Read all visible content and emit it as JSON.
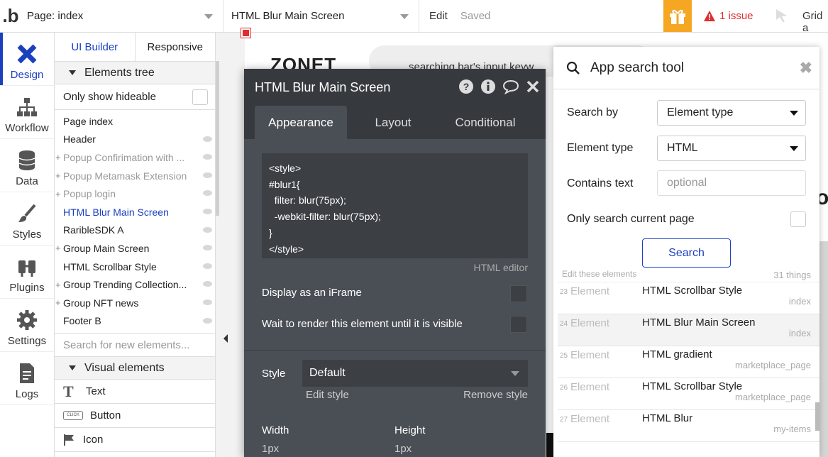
{
  "topbar": {
    "logo": ".b",
    "page_select": "Page: index",
    "element_select": "HTML Blur Main Screen",
    "edit": "Edit",
    "saved": "Saved",
    "issues": "1 issue",
    "grid": "Grid a",
    "accent": "#f5a623",
    "issue_color": "#e02e2e"
  },
  "leftnav": [
    {
      "label": "Design",
      "icon": "design-icon",
      "active": true
    },
    {
      "label": "Workflow",
      "icon": "workflow-icon"
    },
    {
      "label": "Data",
      "icon": "database-icon"
    },
    {
      "label": "Styles",
      "icon": "brush-icon"
    },
    {
      "label": "Plugins",
      "icon": "plug-icon"
    },
    {
      "label": "Settings",
      "icon": "gear-icon"
    },
    {
      "label": "Logs",
      "icon": "document-icon"
    }
  ],
  "panel": {
    "tabs": [
      "UI Builder",
      "Responsive"
    ],
    "elements_tree": "Elements tree",
    "only_hideable": "Only show hideable",
    "tree": [
      {
        "label": "Page index"
      },
      {
        "label": "Header"
      },
      {
        "label": "Popup Confirimation with ...",
        "plus": "+",
        "dim": true
      },
      {
        "label": "Popup Metamask Extension",
        "plus": "+",
        "dim": true
      },
      {
        "label": "Popup login",
        "plus": "+",
        "dim": true
      },
      {
        "label": "HTML Blur Main Screen",
        "selected": true
      },
      {
        "label": "RaribleSDK A"
      },
      {
        "label": "Group Main Screen",
        "plus": "+"
      },
      {
        "label": "HTML Scrollbar Style"
      },
      {
        "label": "Group Trending Collection...",
        "plus": "+"
      },
      {
        "label": "Group NFT news",
        "plus": "+"
      },
      {
        "label": "Footer B"
      }
    ],
    "search_placeholder": "Search for new elements...",
    "visual_elements": "Visual elements",
    "visual": [
      {
        "label": "Text",
        "icon": "text-icon"
      },
      {
        "label": "Button",
        "icon": "button-icon"
      },
      {
        "label": "Icon",
        "icon": "flag-icon"
      }
    ]
  },
  "canvas": {
    "brand": "ZONET",
    "search_text": "searching bar's input keyw"
  },
  "editor": {
    "title": "HTML Blur Main Screen",
    "tabs": [
      "Appearance",
      "Layout",
      "Conditional"
    ],
    "code": "<style>\n#blur1{\n  filter: blur(75px);\n  -webkit-filter: blur(75px);\n}\n</style>",
    "html_editor": "HTML editor",
    "iframe_label": "Display as an iFrame",
    "wait_label": "Wait to render this element until it is visible",
    "style_label": "Style",
    "style_value": "Default",
    "edit_style": "Edit style",
    "remove_style": "Remove style",
    "width_label": "Width",
    "width_value": "1px",
    "height_label": "Height",
    "height_value": "1px"
  },
  "tool": {
    "title": "App search tool",
    "search_by_label": "Search by",
    "search_by_value": "Element type",
    "element_type_label": "Element type",
    "element_type_value": "HTML",
    "contains_label": "Contains text",
    "contains_placeholder": "optional",
    "only_current_label": "Only search current page",
    "search_button": "Search",
    "edit_these": "Edit these elements",
    "count": "31 things",
    "results": [
      {
        "num": "23",
        "kind": "Element",
        "name": "HTML Scrollbar Style",
        "page": "index"
      },
      {
        "num": "24",
        "kind": "Element",
        "name": "HTML Blur Main Screen",
        "page": "index",
        "highlight": true
      },
      {
        "num": "25",
        "kind": "Element",
        "name": "HTML gradient",
        "page": "marketplace_page"
      },
      {
        "num": "26",
        "kind": "Element",
        "name": "HTML Scrollbar Style",
        "page": "marketplace_page"
      },
      {
        "num": "27",
        "kind": "Element",
        "name": "HTML Blur",
        "page": "my-items"
      }
    ]
  }
}
